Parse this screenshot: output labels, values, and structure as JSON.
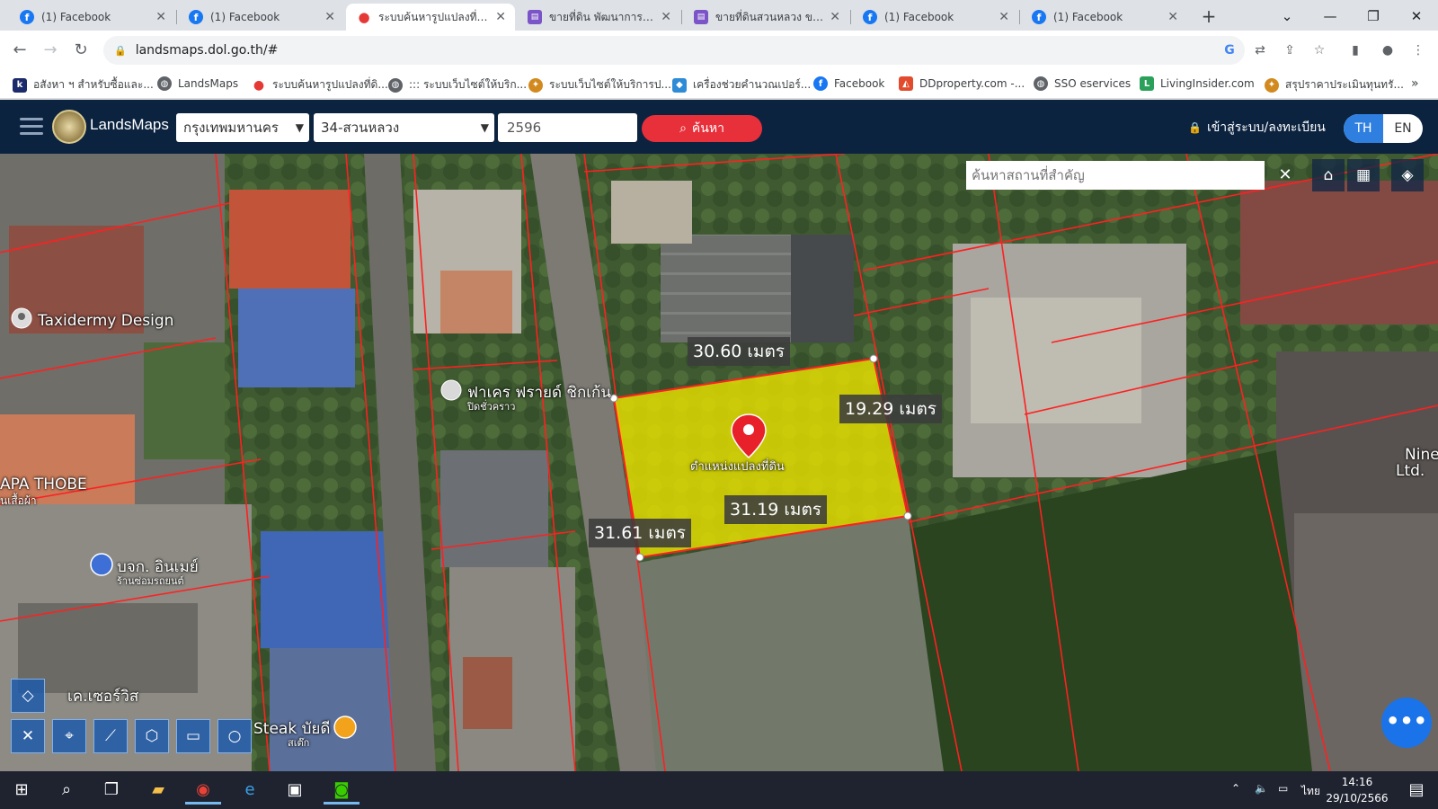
{
  "tabs": [
    {
      "title": "(1) Facebook",
      "icon": "facebook-icon",
      "active": false
    },
    {
      "title": "(1) Facebook",
      "icon": "facebook-icon",
      "active": false
    },
    {
      "title": "ระบบค้นหารูปแปลงที่ดิน",
      "icon": "map-pin-icon",
      "active": true
    },
    {
      "title": "ขายที่ดิน พัฒนาการ30 /",
      "icon": "doc-icon",
      "active": false
    },
    {
      "title": "ขายที่ดินสวนหลวง ขายที่",
      "icon": "doc-icon",
      "active": false
    },
    {
      "title": "(1) Facebook",
      "icon": "facebook-icon",
      "active": false
    },
    {
      "title": "(1) Facebook",
      "icon": "facebook-icon",
      "active": false
    }
  ],
  "new_tab_label": "+",
  "window_controls": {
    "dropdown": "⌄",
    "minimize": "—",
    "maximize": "❐",
    "close": "✕"
  },
  "url": "landsmaps.dol.go.th/#",
  "bookmarks": [
    {
      "label": "อสังหา ฯ สำหรับซื้อและ...",
      "icon": "k-icon",
      "color": "#1b2a6b"
    },
    {
      "label": "LandsMaps",
      "icon": "globe-icon",
      "color": "#5f6368"
    },
    {
      "label": "ระบบค้นหารูปแปลงที่ดิ...",
      "icon": "map-pin-icon",
      "color": "#e53935"
    },
    {
      "label": "::: ระบบเว็บไซต์ให้บริก...",
      "icon": "globe-icon",
      "color": "#5f6368"
    },
    {
      "label": "ระบบเว็บไซต์ให้บริการป...",
      "icon": "seal-icon",
      "color": "#d28a1e"
    },
    {
      "label": "เครื่องช่วยคำนวณเปอร์...",
      "icon": "shield-icon",
      "color": "#2e8bd6"
    },
    {
      "label": "Facebook",
      "icon": "facebook-icon",
      "color": "#1877f2"
    },
    {
      "label": "DDproperty.com -...",
      "icon": "ddproperty-icon",
      "color": "#e24b2d"
    },
    {
      "label": "SSO eservices",
      "icon": "globe-icon",
      "color": "#5f6368"
    },
    {
      "label": "LivingInsider.com",
      "icon": "livinginsider-icon",
      "color": "#2aa05a"
    },
    {
      "label": "สรุปราคาประเมินทุนทรั...",
      "icon": "seal-icon",
      "color": "#d28a1e"
    }
  ],
  "bookmarks_more": "»",
  "app": {
    "brand": "LandsMaps",
    "province": "กรุงเทพมหานคร",
    "district": "34-สวนหลวง",
    "parcel_number": "2596",
    "search_label": "ค้นหา",
    "login_label": "เข้าสู่ระบบ/ลงทะเบียน",
    "lang_th": "TH",
    "lang_en": "EN"
  },
  "map": {
    "place_search_placeholder": "ค้นหาสถานที่สำคัญ",
    "clear_label": "✕",
    "parcel_color": "#e6e100",
    "boundary_color": "#ff2020",
    "pin_label": "ตำแหน่งแปลงที่ดิน",
    "dimensions": [
      "30.60 เมตร",
      "19.29 เมตร",
      "31.19 เมตร",
      "31.61 เมตร"
    ],
    "places": [
      {
        "name": "Taxidermy Design"
      },
      {
        "name": "ฟาเคร ฟรายด์ ชิกเก้น"
      },
      {
        "name": "ปิดชั่วคราว"
      },
      {
        "name": "APA THOBE"
      },
      {
        "name": "นเสื้อผ้า"
      },
      {
        "name": "บจก. อินเมย์"
      },
      {
        "name": "ร้านซ่อมรถยนต์"
      },
      {
        "name": "เค.เซอร์วิส"
      },
      {
        "name": "Steak บัยดี"
      },
      {
        "name": "สเต๊ก"
      },
      {
        "name": "Nine"
      },
      {
        "name": "Ltd."
      }
    ],
    "chat_label": "•••"
  },
  "taskbar": {
    "lang": "ไทย",
    "time": "14:16",
    "date": "29/10/2566"
  }
}
